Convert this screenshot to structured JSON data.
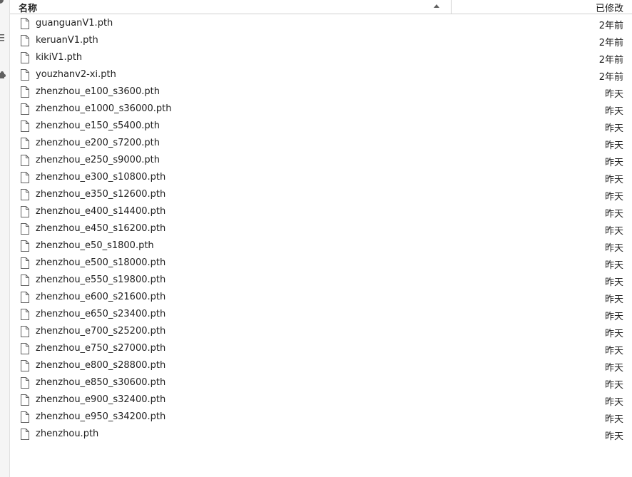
{
  "header": {
    "name_label": "名称",
    "modified_label": "已修改"
  },
  "files": [
    {
      "name": "guanguanV1.pth",
      "modified": "2年前"
    },
    {
      "name": "keruanV1.pth",
      "modified": "2年前"
    },
    {
      "name": "kikiV1.pth",
      "modified": "2年前"
    },
    {
      "name": "youzhanv2-xi.pth",
      "modified": "2年前"
    },
    {
      "name": "zhenzhou_e100_s3600.pth",
      "modified": "昨天"
    },
    {
      "name": "zhenzhou_e1000_s36000.pth",
      "modified": "昨天"
    },
    {
      "name": "zhenzhou_e150_s5400.pth",
      "modified": "昨天"
    },
    {
      "name": "zhenzhou_e200_s7200.pth",
      "modified": "昨天"
    },
    {
      "name": "zhenzhou_e250_s9000.pth",
      "modified": "昨天"
    },
    {
      "name": "zhenzhou_e300_s10800.pth",
      "modified": "昨天"
    },
    {
      "name": "zhenzhou_e350_s12600.pth",
      "modified": "昨天"
    },
    {
      "name": "zhenzhou_e400_s14400.pth",
      "modified": "昨天"
    },
    {
      "name": "zhenzhou_e450_s16200.pth",
      "modified": "昨天"
    },
    {
      "name": "zhenzhou_e50_s1800.pth",
      "modified": "昨天"
    },
    {
      "name": "zhenzhou_e500_s18000.pth",
      "modified": "昨天"
    },
    {
      "name": "zhenzhou_e550_s19800.pth",
      "modified": "昨天"
    },
    {
      "name": "zhenzhou_e600_s21600.pth",
      "modified": "昨天"
    },
    {
      "name": "zhenzhou_e650_s23400.pth",
      "modified": "昨天"
    },
    {
      "name": "zhenzhou_e700_s25200.pth",
      "modified": "昨天"
    },
    {
      "name": "zhenzhou_e750_s27000.pth",
      "modified": "昨天"
    },
    {
      "name": "zhenzhou_e800_s28800.pth",
      "modified": "昨天"
    },
    {
      "name": "zhenzhou_e850_s30600.pth",
      "modified": "昨天"
    },
    {
      "name": "zhenzhou_e900_s32400.pth",
      "modified": "昨天"
    },
    {
      "name": "zhenzhou_e950_s34200.pth",
      "modified": "昨天"
    },
    {
      "name": "zhenzhou.pth",
      "modified": "昨天"
    }
  ],
  "icons": {
    "file": "file-icon",
    "sort": "sort-ascending-icon"
  }
}
